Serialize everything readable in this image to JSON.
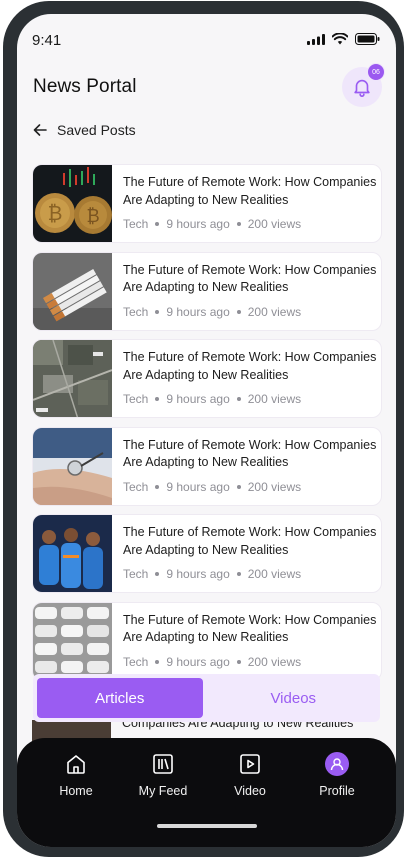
{
  "status_bar": {
    "time": "9:41"
  },
  "header": {
    "title": "News Portal",
    "notification_count": "06"
  },
  "subheader": {
    "label": "Saved Posts"
  },
  "posts": [
    {
      "title": "The Future of Remote Work: How Companies Are Adapting to New Realities",
      "category": "Tech",
      "time": "9 hours ago",
      "views": "200 views",
      "thumb": "bitcoin"
    },
    {
      "title": "The Future of Remote Work: How Companies Are Adapting to New Realities",
      "category": "Tech",
      "time": "9 hours ago",
      "views": "200 views",
      "thumb": "cigarettes"
    },
    {
      "title": "The Future of Remote Work: How Companies Are Adapting to New Realities",
      "category": "Tech",
      "time": "9 hours ago",
      "views": "200 views",
      "thumb": "map"
    },
    {
      "title": "The Future of Remote Work: How Companies Are Adapting to New Realities",
      "category": "Tech",
      "time": "9 hours ago",
      "views": "200 views",
      "thumb": "blood-pressure"
    },
    {
      "title": "The Future of Remote Work: How Companies Are Adapting to New Realities",
      "category": "Tech",
      "time": "9 hours ago",
      "views": "200 views",
      "thumb": "cricket"
    },
    {
      "title": "The Future of Remote Work: How Companies Are Adapting to New Realities",
      "category": "Tech",
      "time": "9 hours ago",
      "views": "200 views",
      "thumb": "cars"
    }
  ],
  "peek_post": {
    "title_partial": "Companies Are Adapting to New Realities"
  },
  "toggle": {
    "active": "Articles",
    "inactive": "Videos"
  },
  "nav": {
    "items": [
      {
        "label": "Home",
        "icon": "home-icon"
      },
      {
        "label": "My Feed",
        "icon": "feed-icon"
      },
      {
        "label": "Video",
        "icon": "video-icon"
      },
      {
        "label": "Profile",
        "icon": "profile-icon"
      }
    ],
    "active": "Profile"
  },
  "colors": {
    "accent": "#9a5cf2",
    "accent_light": "#f2e9fd",
    "nav_bg": "#0c0c0e",
    "screen_bg": "#f7f6f8"
  }
}
